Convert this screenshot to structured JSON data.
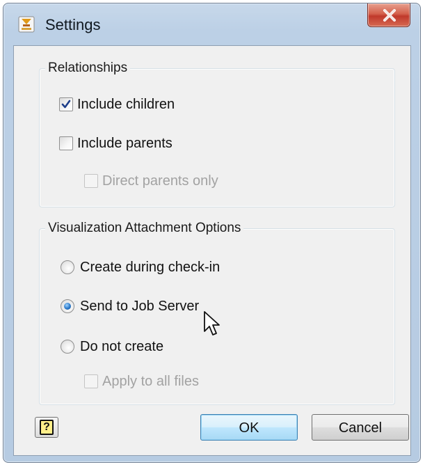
{
  "window": {
    "title": "Settings",
    "close_label": "X"
  },
  "relationships": {
    "title": "Relationships",
    "include_children": {
      "label": "Include children",
      "checked": true,
      "enabled": true
    },
    "include_parents": {
      "label": "Include parents",
      "checked": false,
      "enabled": true
    },
    "direct_parents_only": {
      "label": "Direct parents only",
      "checked": false,
      "enabled": false
    }
  },
  "visualization": {
    "title": "Visualization Attachment Options",
    "create_during_checkin": {
      "label": "Create during check-in",
      "selected": false
    },
    "send_to_job_server": {
      "label": "Send to Job Server",
      "selected": true
    },
    "do_not_create": {
      "label": "Do not create",
      "selected": false
    },
    "apply_to_all_files": {
      "label": "Apply to all files",
      "checked": false,
      "enabled": false
    }
  },
  "footer": {
    "help_label": "?",
    "ok_label": "OK",
    "cancel_label": "Cancel"
  },
  "icons": {
    "app": "autodesk-vault-icon",
    "close": "close-icon",
    "help": "help-icon",
    "cursor": "mouse-pointer-icon"
  },
  "colors": {
    "title_bar": "#bcd0e6",
    "close_button": "#c0392b",
    "dialog_background": "#f0f0f0",
    "default_button": "#bee6fd",
    "radio_selected": "#2a78c8",
    "disabled_text": "#a2a2a2"
  }
}
